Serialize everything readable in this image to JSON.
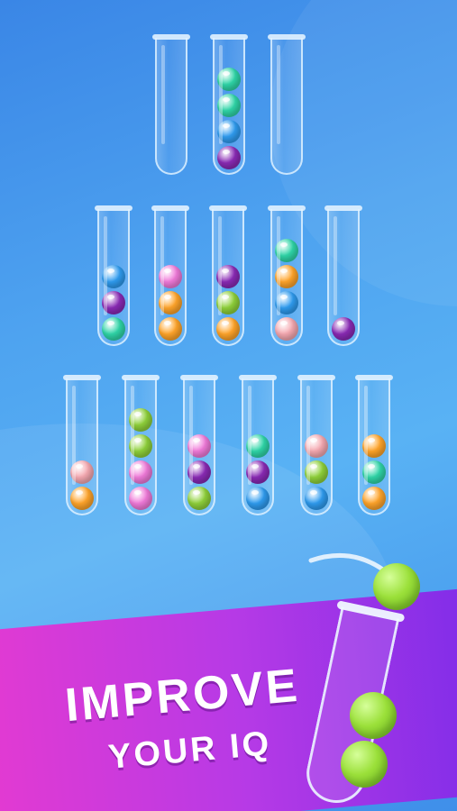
{
  "headline": {
    "line1": "IMPROVE",
    "line2": "YOUR IQ"
  },
  "colors": {
    "green": "#2fd6a8",
    "blue": "#2f9cf0",
    "purple": "#8a2ab5",
    "pink": "#f07ad9",
    "orange": "#ffa42a",
    "lime": "#8fd13a",
    "peach": "#f5a8b0",
    "lime_big": "#9be03a",
    "banner_start": "#e23ad2",
    "banner_end": "#7d2ce8"
  },
  "rows": [
    {
      "tubes": [
        {
          "name": "tube-1",
          "balls": []
        },
        {
          "name": "tube-2",
          "balls": [
            "green",
            "green",
            "blue",
            "purple"
          ]
        },
        {
          "name": "tube-3",
          "balls": []
        }
      ]
    },
    {
      "tubes": [
        {
          "name": "tube-4",
          "balls": [
            "blue",
            "purple",
            "green"
          ]
        },
        {
          "name": "tube-5",
          "balls": [
            "pink",
            "orange",
            "orange"
          ]
        },
        {
          "name": "tube-6",
          "balls": [
            "purple",
            "lime",
            "orange"
          ]
        },
        {
          "name": "tube-7",
          "balls": [
            "green",
            "orange",
            "blue",
            "peach"
          ]
        },
        {
          "name": "tube-8",
          "balls": [
            "purple"
          ]
        }
      ]
    },
    {
      "tubes": [
        {
          "name": "tube-9",
          "balls": [
            "peach",
            "orange"
          ]
        },
        {
          "name": "tube-10",
          "balls": [
            "lime",
            "lime",
            "pink",
            "pink"
          ]
        },
        {
          "name": "tube-11",
          "balls": [
            "pink",
            "purple",
            "lime"
          ]
        },
        {
          "name": "tube-12",
          "balls": [
            "green",
            "purple",
            "blue"
          ]
        },
        {
          "name": "tube-13",
          "balls": [
            "peach",
            "lime",
            "blue"
          ]
        },
        {
          "name": "tube-14",
          "balls": [
            "orange",
            "green",
            "orange"
          ]
        }
      ]
    }
  ],
  "big_tube": {
    "balls": [
      "lime_big",
      "lime_big"
    ],
    "falling_ball": "lime_big"
  }
}
